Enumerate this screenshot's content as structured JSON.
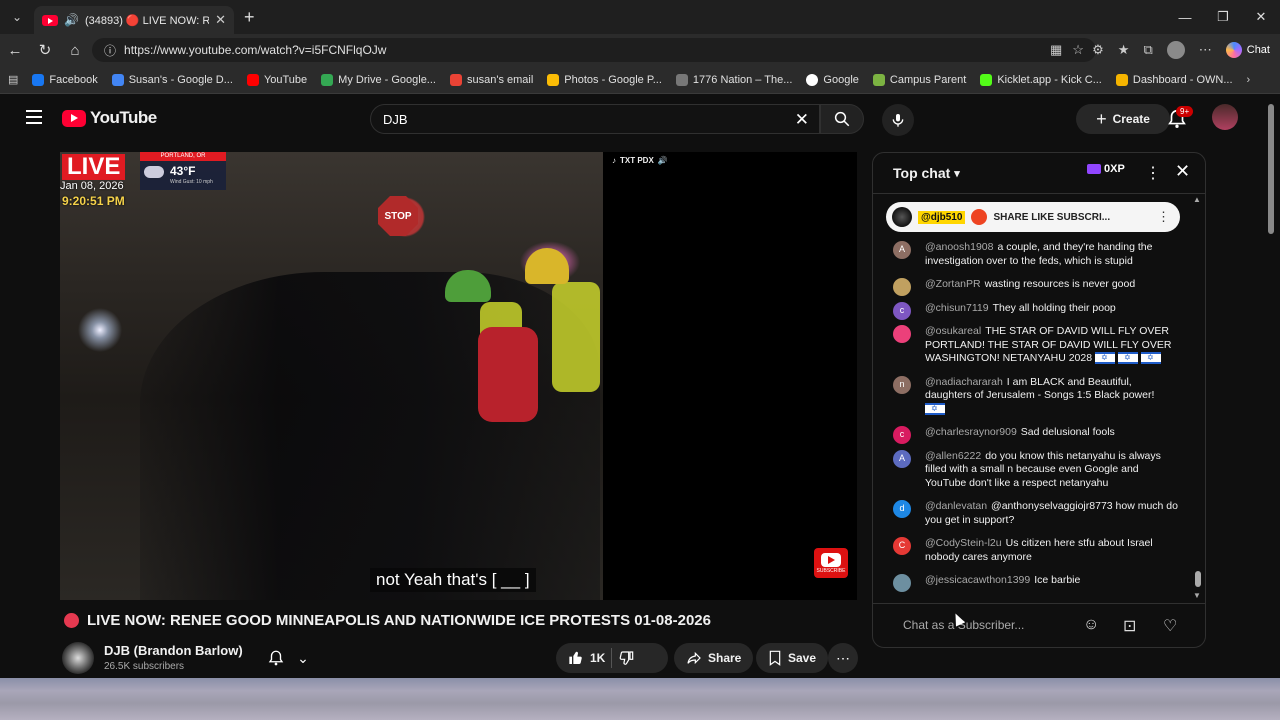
{
  "browser": {
    "tab_title": "(34893) 🔴 LIVE NOW: RENE",
    "url": "https://www.youtube.com/watch?v=i5FCNFlqOJw",
    "chat_button": "Chat",
    "bookmarks": [
      {
        "label": "Facebook",
        "color": "#1877f2"
      },
      {
        "label": "Susan's - Google D...",
        "color": "#4285f4"
      },
      {
        "label": "YouTube",
        "color": "#ff0000"
      },
      {
        "label": "My Drive - Google...",
        "color": "#34a853"
      },
      {
        "label": "susan's email",
        "color": "#ea4335"
      },
      {
        "label": "Photos - Google P...",
        "color": "#fbbc05"
      },
      {
        "label": "1776 Nation – The...",
        "color": "#777777"
      },
      {
        "label": "Google",
        "color": "#ffffff"
      },
      {
        "label": "Campus Parent",
        "color": "#7cb342"
      },
      {
        "label": "Kicklet.app - Kick C...",
        "color": "#53fc18"
      },
      {
        "label": "Dashboard - OWN...",
        "color": "#f5b400"
      }
    ]
  },
  "youtube": {
    "logo_text": "YouTube",
    "search_value": "DJB",
    "create_label": "Create",
    "notification_badge": "9+"
  },
  "video": {
    "live_label": "LIVE",
    "weather_city": "PORTLAND, OR",
    "weather_temp": "43°F",
    "weather_wind": "Wind Gust: 10 mph",
    "date": "Jan 08, 2026",
    "time": "9:20:51 PM",
    "stop_sign": "STOP",
    "tiktok_label": "TXT PDX",
    "caption": "not Yeah that's [ __ ]",
    "subscribe_label": "SUBSCRIBE",
    "title": "LIVE NOW: RENEE GOOD MINNEAPOLIS AND NATIONWIDE ICE PROTESTS 01-08-2026",
    "channel_name": "DJB (Brandon Barlow)",
    "subscribers": "26.5K subscribers",
    "likes": "1K",
    "share_label": "Share",
    "save_label": "Save"
  },
  "chat": {
    "header": "Top chat",
    "xp": "0XP",
    "pinned_user": "@djb510",
    "pinned_text": "SHARE LIKE SUBSCRI...",
    "input_placeholder": "Chat as a Subscriber...",
    "messages": [
      {
        "initial": "A",
        "color": "#8d6e63",
        "user": "@anoosh1908",
        "text": "a couple, and they're handing the investigation over to the feds, which is stupid"
      },
      {
        "initial": "",
        "color": "#c0a060",
        "user": "@ZortanPR",
        "text": "wasting resources is never good"
      },
      {
        "initial": "c",
        "color": "#7e57c2",
        "user": "@chisun7119",
        "text": "They all holding their poop"
      },
      {
        "initial": "",
        "color": "#ec407a",
        "user": "@osukareal",
        "text": "THE STAR OF DAVID WILL FLY OVER PORTLAND! THE STAR OF DAVID WILL FLY OVER WASHINGTON! NETANYAHU 2028",
        "flags": 3
      },
      {
        "initial": "n",
        "color": "#8d6e63",
        "user": "@nadiachararah",
        "text": "I am BLACK and Beautiful, daughters of Jerusalem - Songs 1:5 Black power!",
        "flags": 1
      },
      {
        "initial": "c",
        "color": "#d81b60",
        "user": "@charlesraynor909",
        "text": "Sad delusional fools"
      },
      {
        "initial": "A",
        "color": "#5c6bc0",
        "user": "@allen6222",
        "text": "do you know this netanyahu is always filled with a small n because even Google and YouTube don't like a respect netanyahu"
      },
      {
        "initial": "d",
        "color": "#1e88e5",
        "user": "@danlevatan",
        "text": "@anthonyselvaggiojr8773 how much do you get in support?"
      },
      {
        "initial": "C",
        "color": "#e53935",
        "user": "@CodyStein-l2u",
        "text": "Us citizen here stfu about Israel nobody cares anymore"
      },
      {
        "initial": "",
        "color": "#6d8fa0",
        "user": "@jessicacawthon1399",
        "text": "Ice barbie"
      }
    ]
  }
}
